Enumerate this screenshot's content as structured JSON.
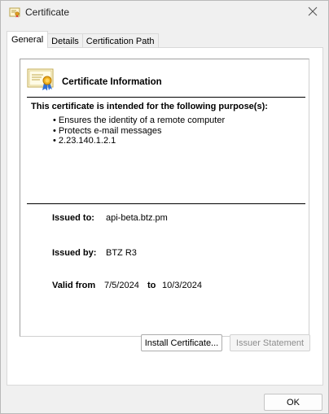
{
  "window": {
    "title": "Certificate",
    "close_glyph": "✕"
  },
  "tabs": [
    {
      "label": "General",
      "active": true
    },
    {
      "label": "Details",
      "active": false
    },
    {
      "label": "Certification Path",
      "active": false
    }
  ],
  "general": {
    "info_title": "Certificate Information",
    "purpose_heading": "This certificate is intended for the following purpose(s):",
    "purposes": [
      "Ensures the identity of a remote computer",
      "Protects e-mail messages",
      "2.23.140.1.2.1"
    ],
    "issued_to_label": "Issued to:",
    "issued_to_value": "api-beta.btz.pm",
    "issued_by_label": "Issued by:",
    "issued_by_value": "BTZ R3",
    "valid_from_label": "Valid from",
    "valid_from_value": "7/5/2024",
    "valid_to_label": "to",
    "valid_to_value": "10/3/2024"
  },
  "buttons": {
    "install": "Install Certificate...",
    "issuer_statement": "Issuer Statement",
    "ok": "OK"
  },
  "icons": {
    "title": "certificate-icon",
    "close": "close-icon",
    "cert_info": "certificate-icon"
  },
  "colors": {
    "window_bg": "#f0f0f0",
    "panel_bg": "#ffffff",
    "disabled_text": "#8d8d8d"
  }
}
